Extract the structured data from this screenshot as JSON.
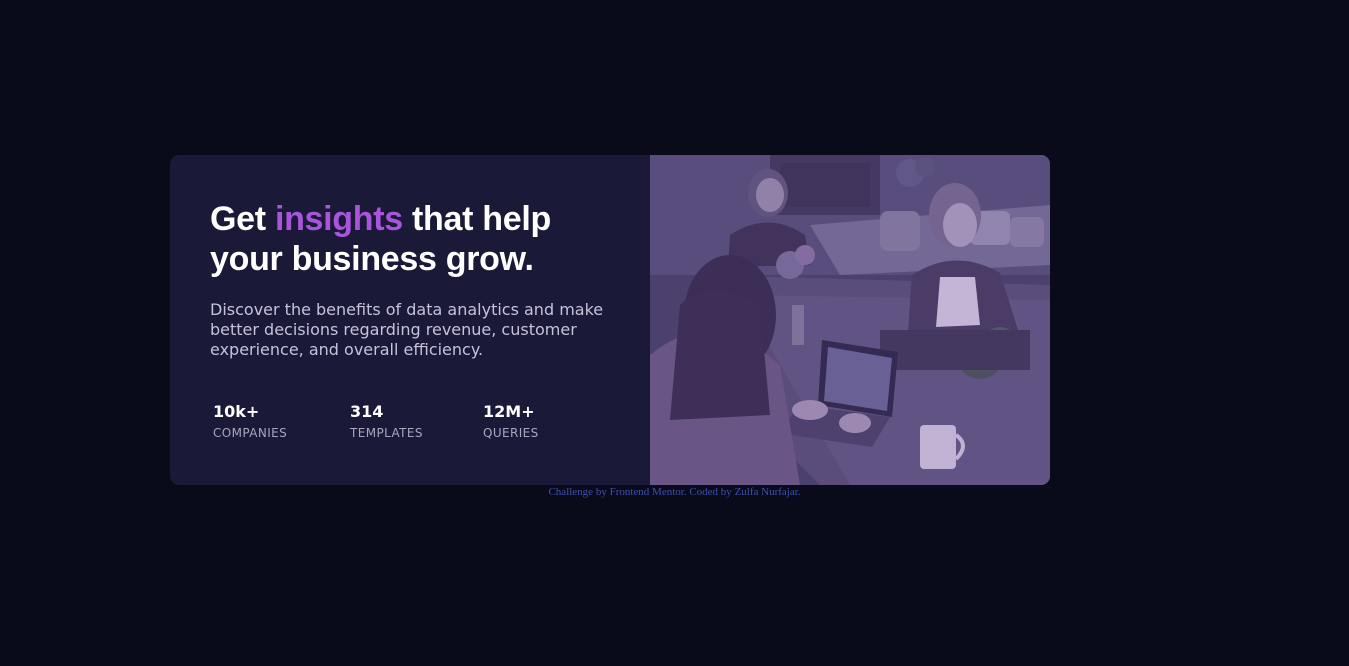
{
  "card": {
    "headline": {
      "before": "Get ",
      "accent": "insights",
      "after": " that help your business grow."
    },
    "description": "Discover the benefits of data analytics and make better decisions regarding revenue, customer experience, and overall efficiency.",
    "stats": [
      {
        "value": "10k+",
        "label": "COMPANIES"
      },
      {
        "value": "314",
        "label": "TEMPLATES"
      },
      {
        "value": "12M+",
        "label": "QUERIES"
      }
    ],
    "image": {
      "icon": "office-photo",
      "overlay_color": "#aa5cdb"
    }
  },
  "attribution": {
    "text_before": "Challenge by ",
    "link1": "Frontend Mentor",
    "text_middle": ". Coded by ",
    "link2": "Zulfa Nurfajar",
    "text_after": "."
  },
  "colors": {
    "page_background": "#090b1a",
    "card_background": "#1b1938",
    "accent": "#a855db",
    "link": "#3f4fb0"
  }
}
